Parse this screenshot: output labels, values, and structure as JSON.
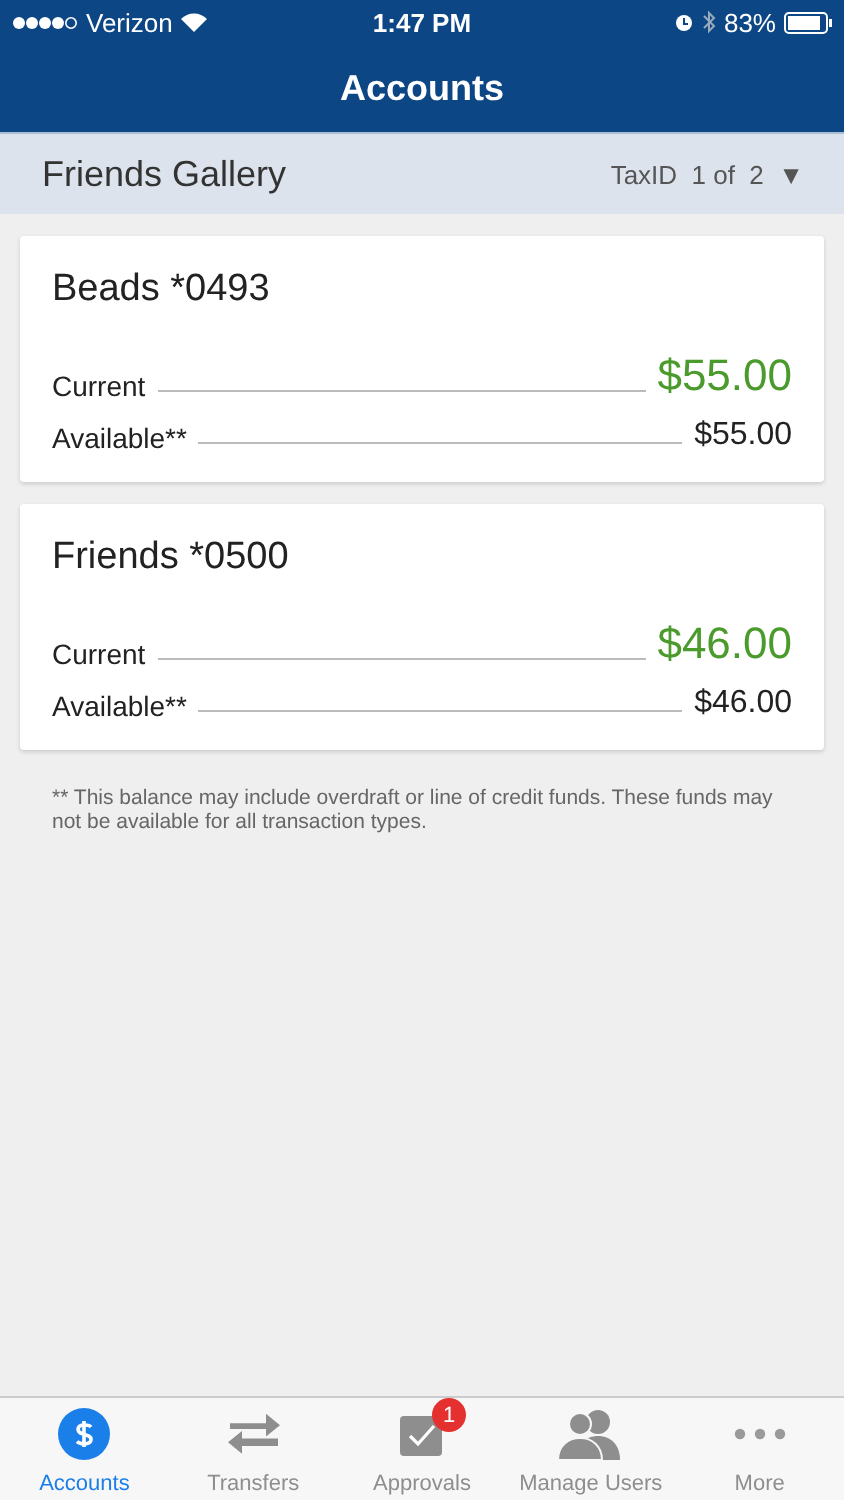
{
  "status_bar": {
    "carrier": "Verizon",
    "time": "1:47 PM",
    "battery": "83%"
  },
  "title": "Accounts",
  "header": {
    "name": "Friends Gallery",
    "taxid_label": "TaxID",
    "page": "1 of",
    "total": "2",
    "caret": "▼"
  },
  "accounts": [
    {
      "name": "Beads *0493",
      "current_label": "Current",
      "current": "$55.00",
      "available_label": "Available**",
      "available": "$55.00"
    },
    {
      "name": "Friends *0500",
      "current_label": "Current",
      "current": "$46.00",
      "available_label": "Available**",
      "available": "$46.00"
    }
  ],
  "footnote": "** This balance may include overdraft or line of credit funds. These funds may not be available for all transaction types.",
  "tabs": [
    {
      "kind": "dollar",
      "label": "Accounts",
      "selected": true
    },
    {
      "kind": "transfer",
      "label": "Transfers",
      "selected": false
    },
    {
      "kind": "check",
      "label": "Approvals",
      "selected": false,
      "badge": "1"
    },
    {
      "kind": "users",
      "label": "Manage Users",
      "selected": false
    },
    {
      "kind": "more",
      "label": "More",
      "selected": false
    }
  ]
}
